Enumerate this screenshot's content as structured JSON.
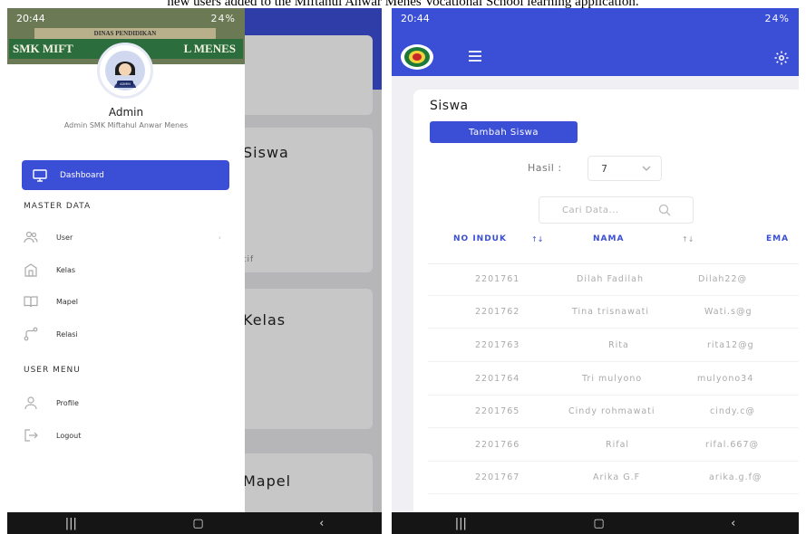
{
  "caption": "new users added to the Miftahul Anwar Menes Vocational School learning application.",
  "left_phone": {
    "status": {
      "time": "20:44",
      "right": "24%"
    },
    "banner_sign": "SMK MIFT",
    "banner_sign_right": "L MENES",
    "banner_sign_top": "DINAS PENDIDIKAN",
    "avatar_badge": "ADMIN",
    "admin_name": "Admin",
    "admin_subtitle": "Admin SMK Miftahul Anwar Menes",
    "nav_dashboard": "Dashboard",
    "section_master": "MASTER DATA",
    "nav_user": "User",
    "nav_kelas": "Kelas",
    "nav_mapel": "Mapel",
    "nav_relasi": "Relasi",
    "section_user_menu": "USER MENU",
    "nav_profile": "Profile",
    "nav_logout": "Logout",
    "bg_card_siswa": "Siswa",
    "bg_card_kelas": "Kelas",
    "bg_card_mapel": "Mapel",
    "bg_card_note": "tif",
    "accent": "#3b4fd6"
  },
  "right_phone": {
    "status": {
      "time": "20:44",
      "right": "24%"
    },
    "page_title": "Siswa",
    "add_button": "Tambah Siswa",
    "hasil_label": "Hasil :",
    "hasil_value": "7",
    "search_placeholder": "Cari Data...",
    "columns": [
      "NO INDUK",
      "NAMA",
      "EMA"
    ],
    "rows": [
      {
        "no_induk": "2201761",
        "nama": "Dilah Fadilah",
        "email": "Dilah22@"
      },
      {
        "no_induk": "2201762",
        "nama": "Tina trisnawati",
        "email": "Wati.s@g"
      },
      {
        "no_induk": "2201763",
        "nama": "Rita",
        "email": "rita12@g"
      },
      {
        "no_induk": "2201764",
        "nama": "Tri mulyono",
        "email": "mulyono34"
      },
      {
        "no_induk": "2201765",
        "nama": "Cindy rohmawati",
        "email": "cindy.c@"
      },
      {
        "no_induk": "2201766",
        "nama": "Rifal",
        "email": "rifal.667@"
      },
      {
        "no_induk": "2201767",
        "nama": "Arika G.F",
        "email": "arika.g.f@"
      }
    ]
  }
}
